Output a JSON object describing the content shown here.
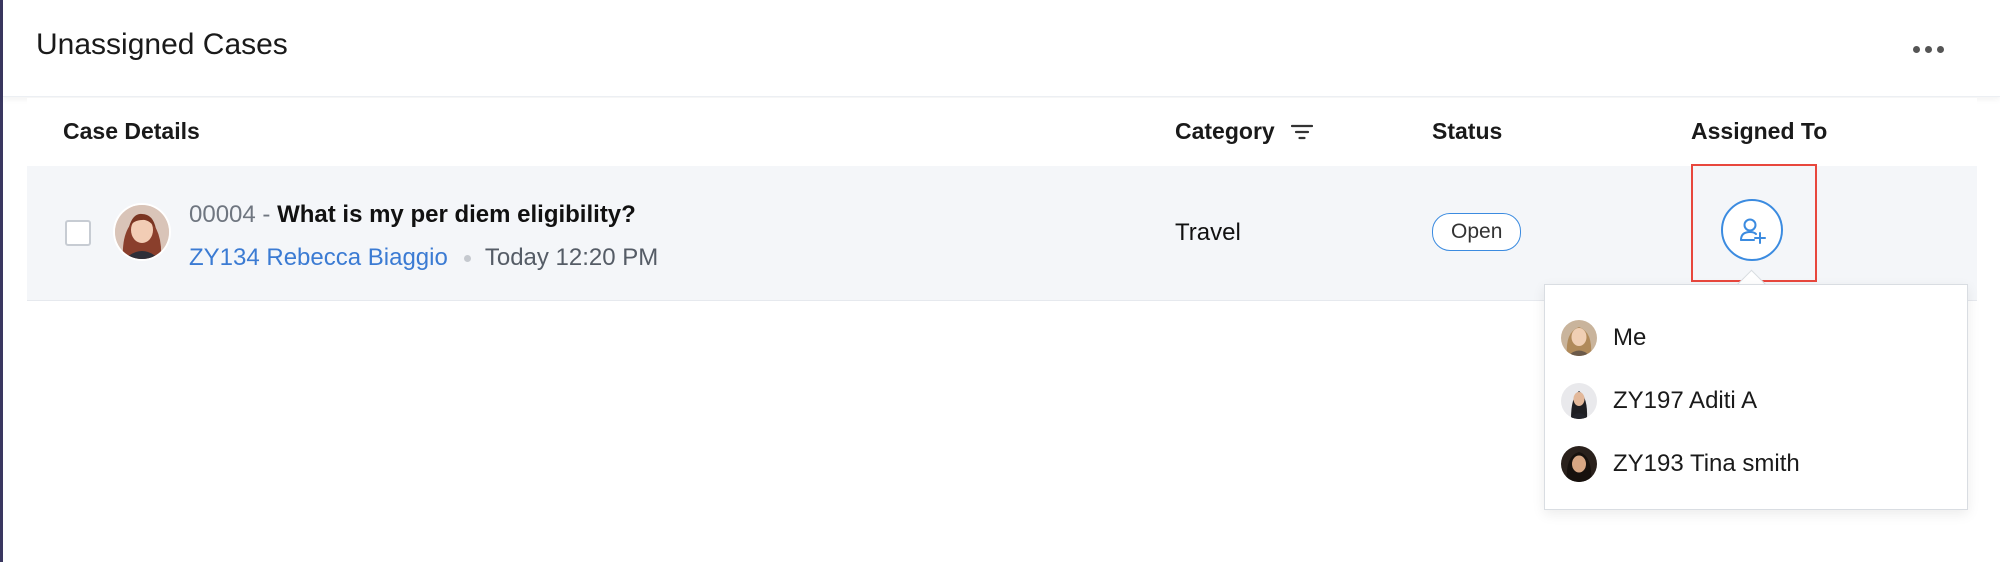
{
  "header": {
    "title": "Unassigned Cases"
  },
  "table": {
    "columns": {
      "case_details": "Case Details",
      "category": "Category",
      "status": "Status",
      "assigned_to": "Assigned To"
    },
    "rows": [
      {
        "case_id": "00004 -",
        "subject": "What is my per diem eligibility?",
        "requester": "ZY134 Rebecca Biaggio",
        "time": "Today 12:20 PM",
        "category": "Travel",
        "status": "Open"
      }
    ]
  },
  "assign_dropdown": {
    "options": [
      {
        "label": "Me",
        "avatar_icon": "user-avatar-me"
      },
      {
        "label": "ZY197 Aditi A",
        "avatar_icon": "user-avatar-aditi"
      },
      {
        "label": "ZY193 Tina smith",
        "avatar_icon": "user-avatar-tina"
      }
    ]
  },
  "colors": {
    "accent_blue": "#3b8be0",
    "link_blue": "#3b7bd3",
    "highlight_red": "#e8473d"
  }
}
